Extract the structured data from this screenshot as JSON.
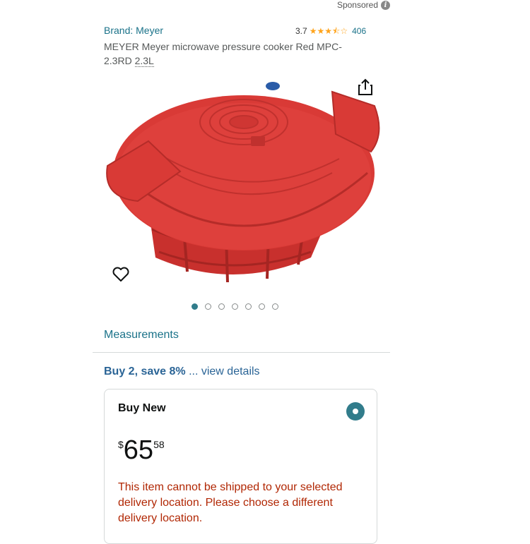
{
  "sponsored": {
    "label": "Sponsored",
    "icon": "info-icon"
  },
  "product": {
    "brand": "Brand: Meyer",
    "rating": "3.7",
    "rating_value": 3.7,
    "review_count": "406",
    "title": "MEYER Meyer microwave pressure cooker Red MPC-2.3RD",
    "size": "2.3L"
  },
  "gallery": {
    "image_count": 7,
    "active_index": 0
  },
  "measurements_link": "Measurements",
  "deal": {
    "strong": "Buy 2, save 8%",
    "rest": " ... view details"
  },
  "buy_new": {
    "title": "Buy New",
    "price_symbol": "$",
    "price_whole": "65",
    "price_fraction": "58",
    "shipping_message": "This item cannot be shipped to your selected delivery location. Please choose a different delivery location."
  },
  "colors": {
    "link": "#1a7289",
    "accent": "#317c8b",
    "star": "#ffa41c",
    "error": "#b12704",
    "product_red": "#d93a36"
  }
}
